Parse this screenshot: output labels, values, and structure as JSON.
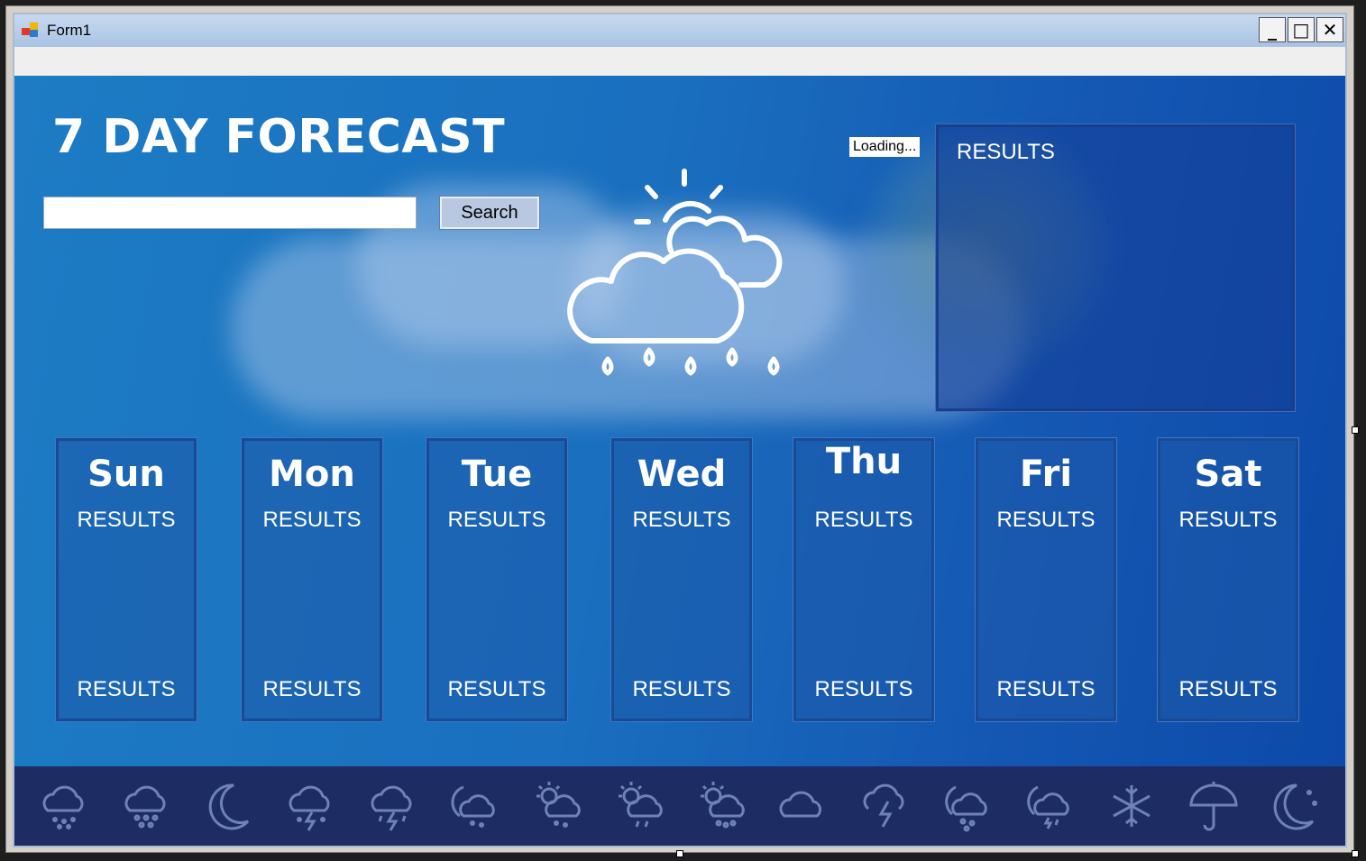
{
  "window": {
    "title": "Form1",
    "minimize": "_",
    "maximize": "□",
    "close": "✕"
  },
  "header": {
    "title": "7 DAY FORECAST"
  },
  "search": {
    "value": "",
    "placeholder": "",
    "button_label": "Search"
  },
  "status": {
    "loading": "Loading..."
  },
  "current": {
    "results": "RESULTS",
    "icon": "cloud-rain-sun-icon"
  },
  "days": [
    {
      "name": "Sun",
      "results_top": "RESULTS",
      "results_bottom": "RESULTS"
    },
    {
      "name": "Mon",
      "results_top": "RESULTS",
      "results_bottom": "RESULTS"
    },
    {
      "name": "Tue",
      "results_top": "RESULTS",
      "results_bottom": "RESULTS"
    },
    {
      "name": "Wed",
      "results_top": "RESULTS",
      "results_bottom": "RESULTS"
    },
    {
      "name": "Thu",
      "results_top": "RESULTS",
      "results_bottom": "RESULTS"
    },
    {
      "name": "Fri",
      "results_top": "RESULTS",
      "results_bottom": "RESULTS"
    },
    {
      "name": "Sat",
      "results_top": "RESULTS",
      "results_bottom": "RESULTS"
    }
  ],
  "footer_icons": [
    "cloud-snow-icon",
    "cloud-hail-icon",
    "moon-icon",
    "cloud-thunder-icon",
    "cloud-thunder-icon",
    "cloud-moon-icon",
    "sun-cloud-snow-icon",
    "sun-cloud-rain-icon",
    "sun-cloud-snow-icon",
    "cloud-icon",
    "cloud-lightning-icon",
    "cloud-moon-snow-icon",
    "cloud-moon-rain-icon",
    "snowflake-icon",
    "umbrella-icon",
    "moon-stars-icon"
  ],
  "colors": {
    "background_start": "#1d7cc4",
    "background_end": "#0c49a8",
    "panel_border": "#1a4a96",
    "footer": "#1d2d64",
    "text": "#ffffff"
  }
}
